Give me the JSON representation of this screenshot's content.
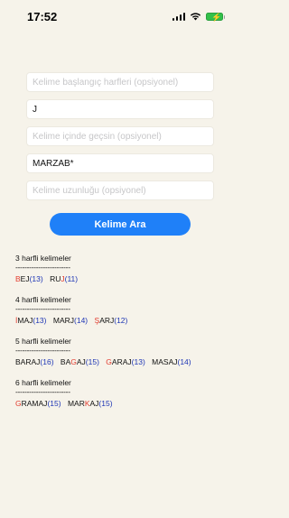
{
  "status_bar": {
    "time": "17:52"
  },
  "form": {
    "fields": [
      {
        "placeholder": "Kelime başlangıç harfleri (opsiyonel)",
        "value": ""
      },
      {
        "placeholder": "",
        "value": "J"
      },
      {
        "placeholder": "Kelime içinde geçsin (opsiyonel)",
        "value": ""
      },
      {
        "placeholder": "",
        "value": "MARZAB*"
      },
      {
        "placeholder": "Kelime uzunluğu (opsiyonel)",
        "value": ""
      }
    ],
    "search_button": "Kelime Ara"
  },
  "results": [
    {
      "title": "3 harfli kelimeler",
      "divider": "------------------------",
      "words": [
        {
          "red": "B",
          "black": "EJ",
          "count": "(13)"
        },
        {
          "red": "",
          "black": "RU",
          "red2": "J",
          "count": "(11)"
        }
      ]
    },
    {
      "title": "4 harfli kelimeler",
      "divider": "------------------------",
      "words": [
        {
          "red": "İ",
          "black": "MAJ",
          "count": "(13)"
        },
        {
          "red": "",
          "black": "MARJ",
          "count": "(14)"
        },
        {
          "red": "Ş",
          "black": "ARJ",
          "count": "(12)"
        }
      ]
    },
    {
      "title": "5 harfli kelimeler",
      "divider": "------------------------",
      "words": [
        {
          "red": "",
          "black": "BARAJ",
          "count": "(16)"
        },
        {
          "red": "",
          "black": "BA",
          "red2": "G",
          "black2": "AJ",
          "count": "(15)"
        },
        {
          "red": "G",
          "black": "ARAJ",
          "count": "(13)"
        },
        {
          "red": "",
          "black": "MASAJ",
          "count": "(14)"
        }
      ]
    },
    {
      "title": "6 harfli kelimeler",
      "divider": "------------------------",
      "words": [
        {
          "red": "G",
          "black": "RAMAJ",
          "count": "(15)"
        },
        {
          "red": "",
          "black": "MAR",
          "red2": "K",
          "black2": "AJ",
          "count": "(15)"
        }
      ]
    }
  ],
  "colors": {
    "accent": "#1f80f8",
    "highlight": "#e23b2e",
    "count": "#1e36b5",
    "background": "#f6f3ea"
  }
}
